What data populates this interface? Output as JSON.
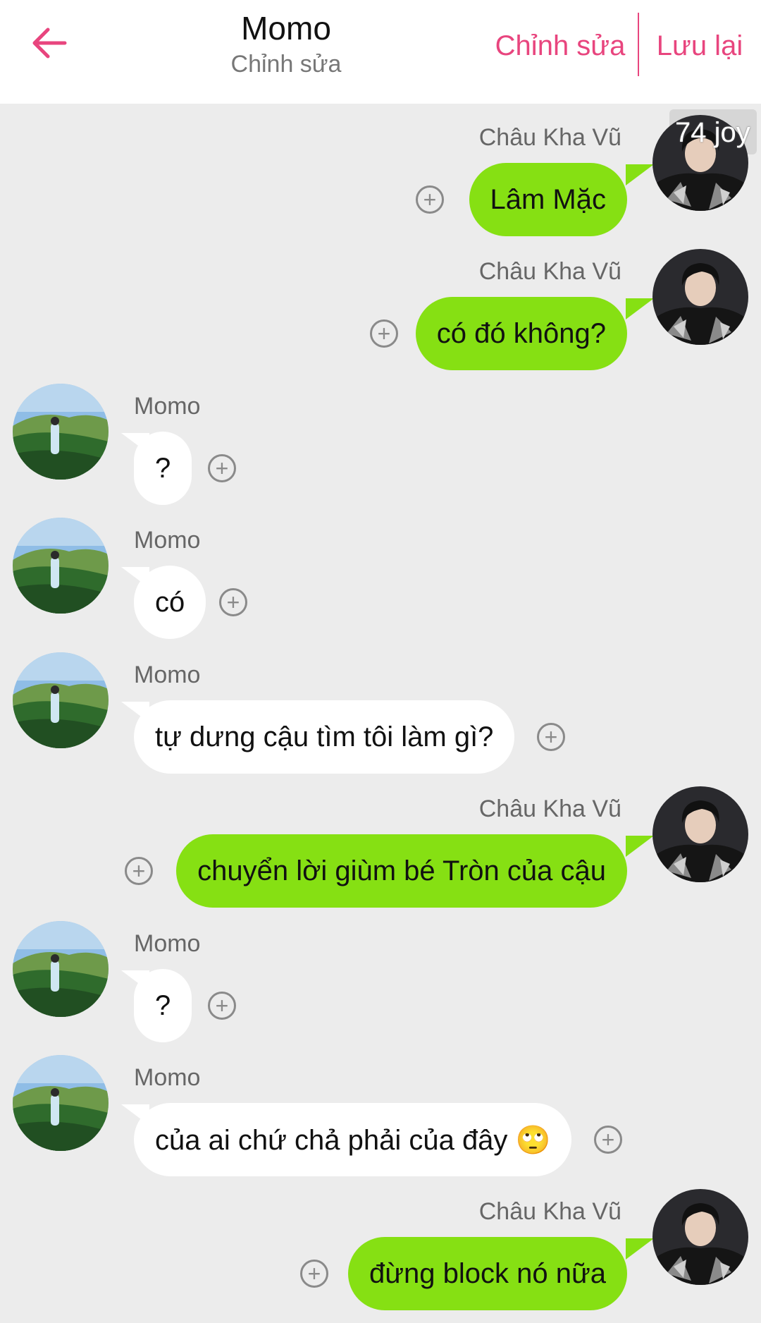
{
  "header": {
    "title": "Momo",
    "subtitle": "Chỉnh sửa",
    "edit_label": "Chỉnh sửa",
    "save_label": "Lưu lại",
    "accent_color": "#e8457e"
  },
  "joy_badge": "74 joy",
  "icons": {
    "back": "arrow-left-icon",
    "add": "plus-circle-icon"
  },
  "colors": {
    "background": "#ececec",
    "my_bubble": "#86e013",
    "their_bubble": "#ffffff"
  },
  "messages": [
    {
      "side": "right",
      "sender": "Châu Kha Vũ",
      "text": "Lâm Mặc"
    },
    {
      "side": "right",
      "sender": "Châu Kha Vũ",
      "text": "có đó không?"
    },
    {
      "side": "left",
      "sender": "Momo",
      "text": "?"
    },
    {
      "side": "left",
      "sender": "Momo",
      "text": "có"
    },
    {
      "side": "left",
      "sender": "Momo",
      "text": "tự dưng cậu tìm tôi làm gì?"
    },
    {
      "side": "right",
      "sender": "Châu Kha Vũ",
      "text": "chuyển lời giùm bé Tròn của cậu"
    },
    {
      "side": "left",
      "sender": "Momo",
      "text": "?"
    },
    {
      "side": "left",
      "sender": "Momo",
      "text": "của ai chứ chả phải của đây 🙄"
    },
    {
      "side": "right",
      "sender": "Châu Kha Vũ",
      "text": "đừng block nó nữa"
    }
  ]
}
